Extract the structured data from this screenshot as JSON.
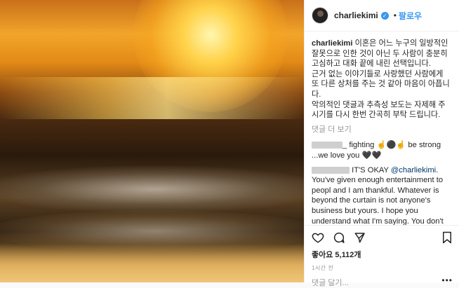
{
  "header": {
    "username": "charliekimi",
    "separator": "•",
    "follow_label": "팔로우"
  },
  "caption": {
    "author": "charliekimi",
    "lines": [
      "이혼은 어느 누구의 일방적인 잘못으로 인한 것이 아닌 두 사람이 충분히 고심하고 대화 끝에 내린 선택입니다.",
      "근거 없는 이야기들로 사랑했던 사람에게 또 다른 상처를 주는 것 같아 마음이 아픕니다.",
      "악의적인 댓글과 추측성 보도는 자제해 주시기를 다시 한번 간곡히 부탁 드립니다."
    ]
  },
  "view_more_label": "댓글 더 보기",
  "comments": [
    {
      "text": "_ fighting ☝️⚫☝️ be strong ...we love you 🖤🖤"
    },
    {
      "text_prefix": "IT'S OKAY",
      "mention": "@charliekimi",
      "text_suffix": ". You've given enough entertainment to peopl and I am thankful. Whatever is beyond the curtain is not anyone's business but yours. I hope you understand what I'm saying. You don't owe people any explanation if you let us see a part of you that is personal becomes a bonus and we"
    }
  ],
  "likes": "좋아요 5,112개",
  "timestamp": "1시간 전",
  "add_comment_placeholder": "댓글 달기...",
  "more_options": "•••",
  "icons": {
    "like": "heart-icon",
    "comment": "comment-icon",
    "share": "share-icon",
    "save": "bookmark-icon",
    "verified": "verified-icon"
  }
}
